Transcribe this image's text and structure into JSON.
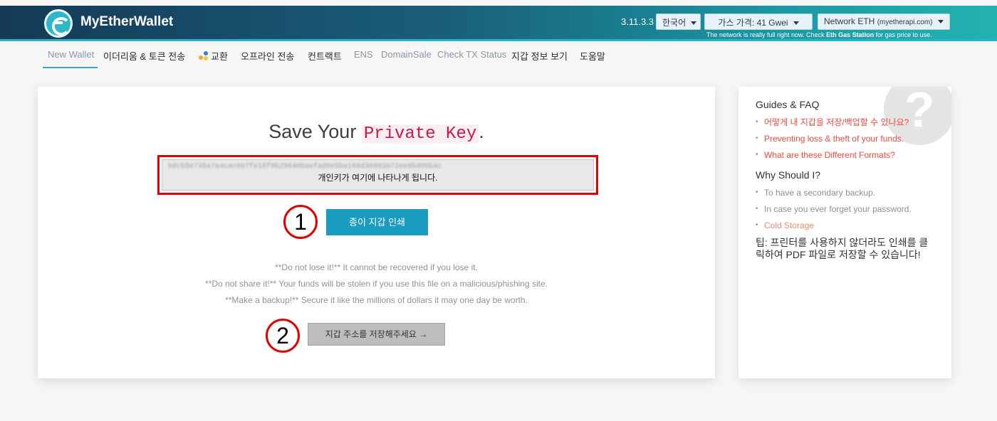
{
  "header": {
    "brand": "MyEtherWallet",
    "version": "3.11.3.3",
    "language": "한국어",
    "gas_price": "가스 가격: 41 Gwei",
    "network": "Network ETH",
    "network_sub": "(myetherapi.com)",
    "notice_prefix": "The network is really full right now. Check",
    "notice_link": "Eth Gas Station",
    "notice_suffix": "for gas price to use."
  },
  "nav": {
    "items": [
      "New Wallet",
      "이더리움 & 토큰 전송",
      "교환",
      "오프라인 전송",
      "컨트랙트",
      "ENS",
      "DomainSale",
      "Check TX Status",
      "지갑 정보 보기",
      "도움말"
    ]
  },
  "main": {
    "title_prefix": "Save Your",
    "title_code": "Private Key",
    "title_suffix": ".",
    "key_blurred": "b8cb5e745a7a4cac697fe18f9b29640baefad0e5ba169d36893072ee9bd05b4c",
    "key_caption": "개인키가 여기에 나타나게 됩니다.",
    "step1": "1",
    "step2": "2",
    "print_button": "종이 지갑 인쇄",
    "warnings": [
      "**Do not lose it!** It cannot be recovered if you lose it.",
      "**Do not share it!** Your funds will be stolen if you use this file on a malicious/phishing site.",
      "**Make a backup!** Secure it like the millions of dollars it may one day be worth."
    ],
    "next_button": "지갑 주소를 저장해주세요 →"
  },
  "sidebar": {
    "qmark": "?",
    "guides_title": "Guides & FAQ",
    "guides": [
      "어떻게 내 지갑을 저장/백업할 수 있나요?",
      "Preventing loss & theft of your funds.",
      "What are these Different Formats?"
    ],
    "why_title": "Why Should I?",
    "why": [
      "To have a secondary backup.",
      "In case you ever forget your password.",
      "Cold Storage"
    ],
    "tip": "팁: 프린터를 사용하지 않더라도 인쇄를 클릭하여 PDF 파일로 저장할 수 있습니다!"
  },
  "colors": {
    "accent": "#1a9cc0",
    "highlight_border": "#e30000",
    "link": "#f0483c"
  }
}
